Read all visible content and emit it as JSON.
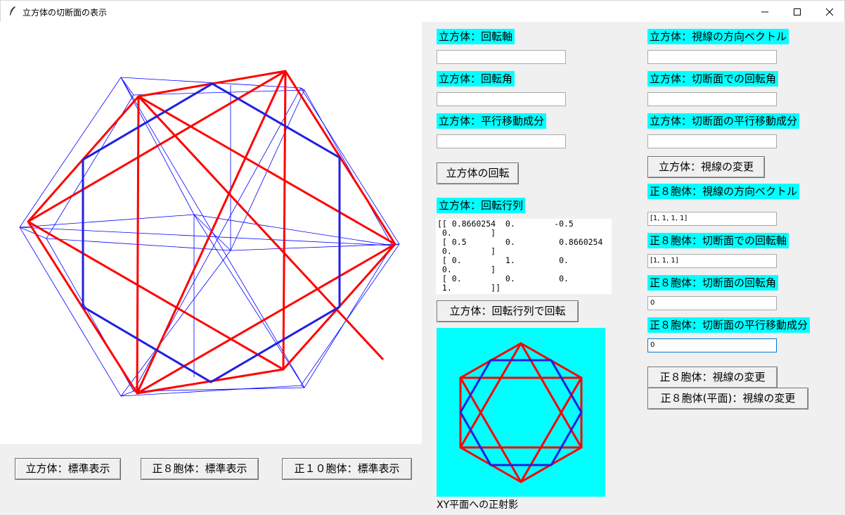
{
  "window": {
    "title": "立方体の切断面の表示",
    "icon": "feather-icon"
  },
  "cube_panel": {
    "axis_label": "立方体：回転軸",
    "axis_value": "",
    "angle_label": "立方体：回転角",
    "angle_value": "",
    "translation_label": "立方体：平行移動成分",
    "translation_value": "",
    "rotate_button": "立方体の回転",
    "matrix_label": "立方体：回転行列",
    "matrix_text": "[[ 0.8660254  0.        -0.5\n 0.        ]\n [ 0.5        0.         0.8660254\n 0.        ]\n [ 0.         1.         0.\n 0.        ]\n [ 0.         0.         0.\n 1.        ]]",
    "matrix_rotate_button": "立方体：回転行列で回転"
  },
  "view_panel": {
    "cube_view_dir_label": "立方体：視線の方向ベクトル",
    "cube_view_dir_value": "",
    "cube_section_angle_label": "立方体：切断面での回転角",
    "cube_section_angle_value": "",
    "cube_section_trans_label": "立方体：切断面の平行移動成分",
    "cube_section_trans_value": "",
    "cube_view_button": "立方体：視線の変更",
    "oct_view_dir_label": "正８胞体：視線の方向ベクトル",
    "oct_view_dir_value": "[1, 1, 1, 1]",
    "oct_section_axis_label": "正８胞体：切断面での回転軸",
    "oct_section_axis_value": "[1, 1, 1]",
    "oct_section_angle_label": "正８胞体：切断面の回転角",
    "oct_section_angle_value": "0",
    "oct_section_trans_label": "正８胞体：切断面の平行移動成分",
    "oct_section_trans_value": "0",
    "oct_view_button": "正８胞体：視線の変更",
    "oct_plane_view_button": "正８胞体(平面)：視線の変更"
  },
  "bottom_buttons": {
    "cube_standard": "立方体：標準表示",
    "oct_standard": "正８胞体：標準表示",
    "deca_standard": "正１０胞体：標準表示"
  },
  "projection": {
    "caption": "XY平面への正射影"
  },
  "colors": {
    "cyan": "#00ffff",
    "edge_red": "#ff0000",
    "edge_blue": "#0000ff",
    "section_blue": "#2020e0"
  }
}
